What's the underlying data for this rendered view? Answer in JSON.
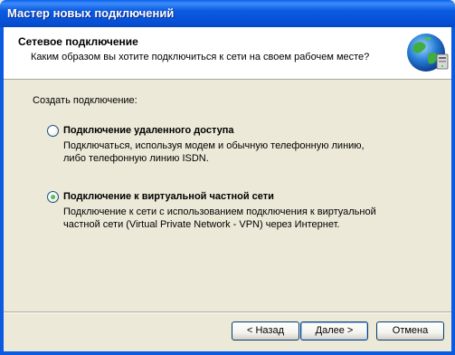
{
  "window": {
    "title": "Мастер новых подключений"
  },
  "header": {
    "title": "Сетевое подключение",
    "subtitle": "Каким образом вы хотите подключиться к сети на своем рабочем месте?",
    "icon": "network-globe-icon"
  },
  "body": {
    "create_label": "Создать подключение:",
    "options": [
      {
        "label": "Подключение удаленного доступа",
        "selected": false,
        "description": [
          "Подключаться, используя модем и обычную телефонную линию,",
          "либо телефонную линию ISDN."
        ]
      },
      {
        "label": "Подключение к виртуальной частной сети",
        "selected": true,
        "description": [
          "Подключение к сети с использованием подключения к виртуальной",
          "частной сети (Virtual Private Network - VPN) через Интернет."
        ]
      }
    ]
  },
  "buttons": {
    "back": "< Назад",
    "next": "Далее >",
    "cancel": "Отмена"
  },
  "colors": {
    "titlebar": "#0a5be0",
    "face": "#ece9d8",
    "radio_dot": "#21a121"
  }
}
